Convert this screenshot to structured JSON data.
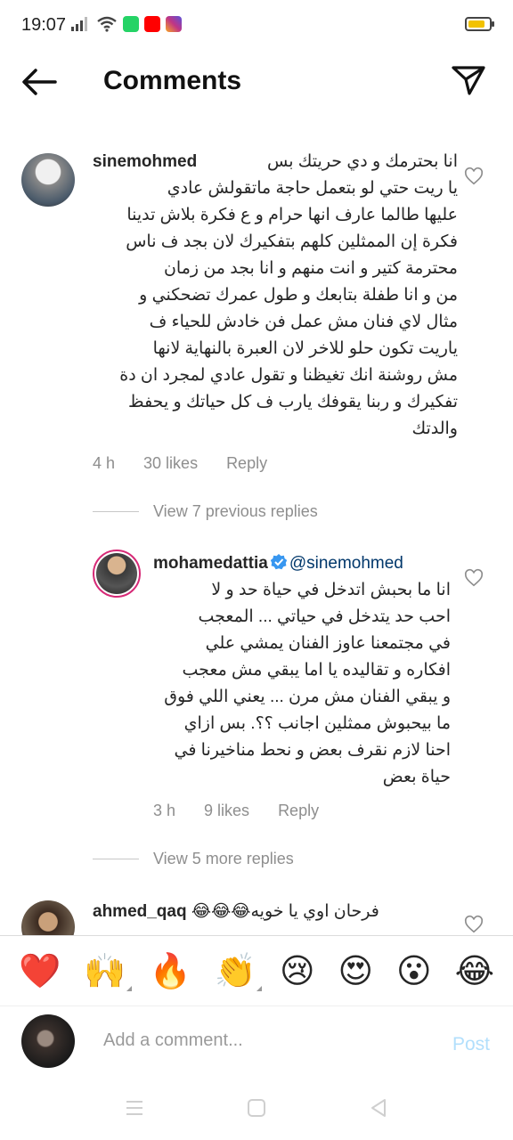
{
  "status_bar": {
    "time": "19:07",
    "battery_level": 0.7,
    "colors": {
      "whatsapp": "#25d366",
      "youtube": "#ff0000",
      "instagram": "#c13584",
      "battery": "#f2c200"
    }
  },
  "header": {
    "title": "Comments",
    "back_icon": "arrow-left-icon",
    "send_icon": "paper-plane-icon"
  },
  "comments": [
    {
      "username": "sinemohmed",
      "text_lines": [
        "انا بحترمك و دي حريتك بس",
        "يا ريت حتي لو بتعمل حاجة ماتقولش عادي",
        "عليها طالما عارف انها حرام و ع فكرة بلاش تدينا",
        "فكرة إن الممثلين كلهم بتفكيرك لان بجد ف ناس",
        "محترمة كتير و انت منهم و انا بجد من زمان",
        "من و انا طفلة بتابعك و طول عمرك تضحكني و",
        "مثال لاي فنان مش عمل فن خادش للحياء ف",
        "ياريت تكون حلو للاخر لان العبرة بالنهاية لانها",
        "مش روشنة انك تغيظنا و تقول عادي لمجرد ان دة",
        "تفكيرك و ربنا يقوفك يارب ف كل حياتك و يحفظ",
        "والدتك"
      ],
      "time": "4 h",
      "likes": "30 likes",
      "reply": "Reply",
      "view_replies": "View 7 previous replies"
    },
    {
      "username": "mohamedattia",
      "verified": true,
      "mention": "@sinemohmed",
      "text_lines": [
        "انا ما بحبش اتدخل في حياة حد و لا",
        "احب حد يتدخل في حياتي ... المعجب",
        "في مجتمعنا عاوز الفنان يمشي علي",
        "افكاره و تقاليده يا اما يبقي مش معجب",
        "و يبقي الفنان مش مرن ... يعني اللي فوق",
        "ما بيحبوش ممثلين اجانب ؟؟. بس ازاي",
        "احنا لازم نقرف بعض و نحط مناخيرنا في",
        "حياة بعض"
      ],
      "time": "3 h",
      "likes": "9 likes",
      "reply": "Reply",
      "view_replies": "View 5 more replies"
    },
    {
      "username": "ahmed_qaq",
      "text": "فرحان اوي يا خويه😂😂😂"
    }
  ],
  "emoji_bar": [
    "❤️",
    "🙌",
    "🔥",
    "👏",
    "😢",
    "😍",
    "😮",
    "😂"
  ],
  "composer": {
    "placeholder": "Add a comment...",
    "post_label": "Post"
  },
  "colors": {
    "text": "#262626",
    "secondary": "#8e8e8e",
    "post_disabled": "#b2dffc",
    "verified": "#3897f0"
  }
}
